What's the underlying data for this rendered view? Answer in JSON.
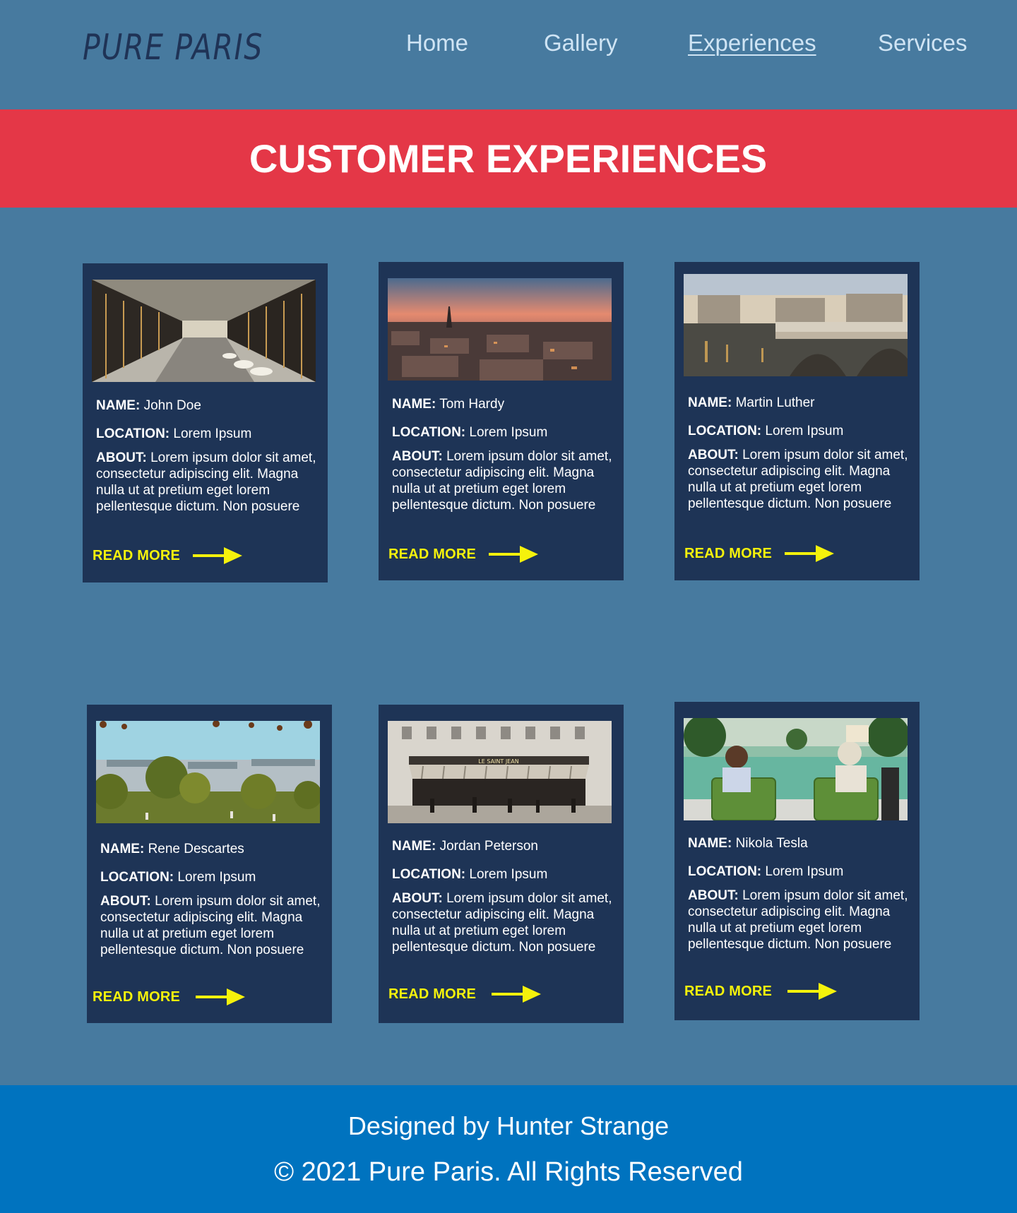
{
  "brand": {
    "logo_text": "PURE PARIS"
  },
  "nav": {
    "items": [
      {
        "label": "Home",
        "active": false
      },
      {
        "label": "Gallery",
        "active": false
      },
      {
        "label": "Experiences",
        "active": true
      },
      {
        "label": "Services",
        "active": false
      }
    ]
  },
  "banner": {
    "title": "CUSTOMER EXPERIENCES"
  },
  "cards": [
    {
      "image_subject": "covered shopping arcade",
      "name_label": "NAME:",
      "name": "John Doe",
      "location_label": "LOCATION:",
      "location": "Lorem Ipsum",
      "about_label": "ABOUT:",
      "about": "Lorem ipsum dolor sit amet, consectetur adipiscing elit. Magna nulla ut at pretium eget lorem pellentesque dictum. Non posuere",
      "cta": "READ MORE"
    },
    {
      "image_subject": "city skyline at sunset with Eiffel Tower",
      "name_label": "NAME:",
      "name": "Tom Hardy",
      "location_label": "LOCATION:",
      "location": "Lorem Ipsum",
      "about_label": "ABOUT:",
      "about": "Lorem ipsum dolor sit amet, consectetur adipiscing elit. Magna nulla ut at pretium eget lorem pellentesque dictum. Non posuere",
      "cta": "READ MORE"
    },
    {
      "image_subject": "stone bridge over the Seine at dusk",
      "name_label": "NAME:",
      "name": "Martin Luther",
      "location_label": "LOCATION:",
      "location": "Lorem Ipsum",
      "about_label": "ABOUT:",
      "about": "Lorem ipsum dolor sit amet, consectetur adipiscing elit. Magna nulla ut at pretium eget lorem pellentesque dictum. Non posuere",
      "cta": "READ MORE"
    },
    {
      "image_subject": "garden with trees and Parisian buildings",
      "name_label": "NAME:",
      "name": "Rene Descartes",
      "location_label": "LOCATION:",
      "location": "Lorem Ipsum",
      "about_label": "ABOUT:",
      "about": "Lorem ipsum dolor sit amet, consectetur adipiscing elit. Magna nulla ut at pretium eget lorem pellentesque dictum. Non posuere",
      "cta": "READ MORE"
    },
    {
      "image_subject": "street cafe with striped awning",
      "image_sign": "LE SAINT JEAN",
      "name_label": "NAME:",
      "name": "Jordan Peterson",
      "location_label": "LOCATION:",
      "location": "Lorem Ipsum",
      "about_label": "ABOUT:",
      "about": "Lorem ipsum dolor sit amet, consectetur adipiscing elit. Magna nulla ut at pretium eget lorem pellentesque dictum. Non posuere",
      "cta": "READ MORE"
    },
    {
      "image_subject": "two people reading in green chairs by a pond",
      "name_label": "NAME:",
      "name": "Nikola Tesla",
      "location_label": "LOCATION:",
      "location": "Lorem Ipsum",
      "about_label": "ABOUT:",
      "about": "Lorem ipsum dolor sit amet, consectetur adipiscing elit. Magna nulla ut at pretium eget lorem pellentesque dictum. Non posuere",
      "cta": "READ MORE"
    }
  ],
  "footer": {
    "credit": "Designed by Hunter Strange",
    "copyright": "© 2021 Pure Paris. All Rights Reserved"
  },
  "colors": {
    "page_bg": "#477a9f",
    "banner_bg": "#e43747",
    "card_bg": "#1e3456",
    "accent_yellow": "#f5f20c",
    "footer_bg": "#0073bf",
    "nav_text": "#cfe4f4",
    "logo_text": "#1f3356"
  },
  "icons": {
    "read_more": "arrow-right-icon"
  }
}
